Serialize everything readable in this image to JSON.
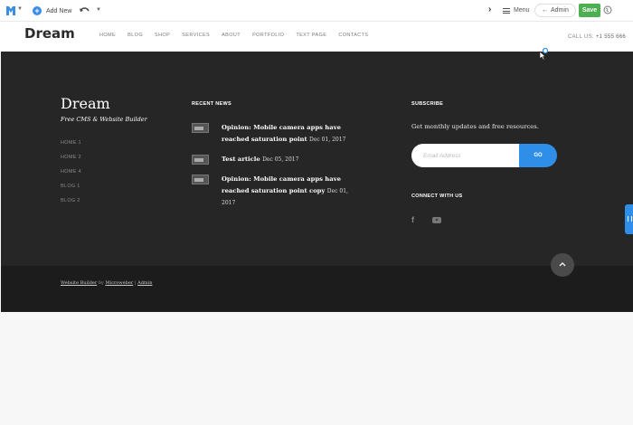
{
  "admin_bar": {
    "add_new_label": "Add New",
    "menu_label": "Menu",
    "admin_label": "Admin",
    "save_label": "Save",
    "colors": {
      "save": "#4caf50",
      "accent": "#3a8ee6"
    }
  },
  "header": {
    "brand": "Dream",
    "nav": [
      "HOME",
      "BLOG",
      "SHOP",
      "SERVICES",
      "ABOUT",
      "PORTFOLIO",
      "TEXT PAGE",
      "CONTACTS"
    ],
    "call_label": "CALL US:",
    "phone": "+1 555 666"
  },
  "footer": {
    "brand": "Dream",
    "tagline": "Free CMS & Website Builder",
    "links": [
      "HOME 1",
      "HOME 2",
      "HOME 4",
      "BLOG 1",
      "BLOG 2"
    ],
    "recent_news_title": "RECENT NEWS",
    "news": [
      {
        "title": "Opinion: Mobile camera apps have reached saturation point",
        "date": "Dec 01, 2017"
      },
      {
        "title": "Test article",
        "date": "Dec 05, 2017"
      },
      {
        "title": "Opinion: Mobile camera apps have reached saturation point copy",
        "date": "Dec 01, 2017"
      }
    ],
    "subscribe_title": "SUBSCRIBE",
    "subscribe_text": "Get monthly updates and free resources.",
    "email_placeholder": "Email Address",
    "go_label": "GO",
    "connect_title": "CONNECT WITH US",
    "social_icons": [
      "facebook-icon",
      "youtube-icon"
    ],
    "credits": {
      "builder": "Website Builder",
      "by": "by",
      "vendor": "Microweber",
      "sep": "|",
      "admin": "Admin"
    },
    "colors": {
      "background": "#262626",
      "bottom": "#1c1c1c",
      "accent": "#2f8fe8"
    }
  }
}
